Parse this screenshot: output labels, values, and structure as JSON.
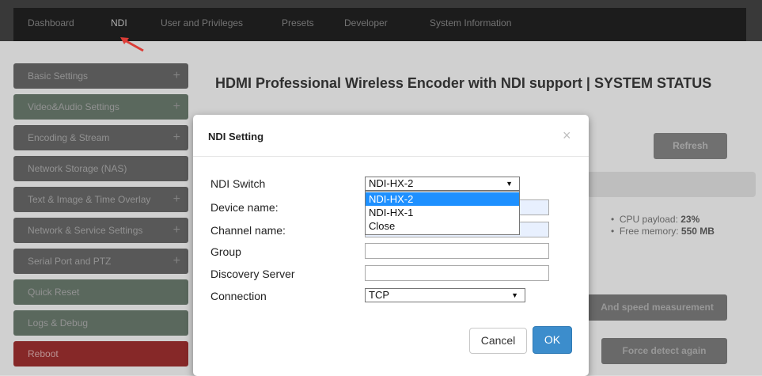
{
  "nav": {
    "tabs": [
      {
        "label": "Dashboard"
      },
      {
        "label": "NDI"
      },
      {
        "label": "User and Privileges"
      },
      {
        "label": "Presets"
      },
      {
        "label": "Developer"
      },
      {
        "label": "System Information"
      }
    ],
    "active_tab": "NDI"
  },
  "sidebar": {
    "items": [
      {
        "label": "Basic Settings",
        "expand": "+"
      },
      {
        "label": "Video&Audio Settings",
        "expand": "+"
      },
      {
        "label": "Encoding & Stream",
        "expand": "+"
      },
      {
        "label": "Network Storage (NAS)",
        "expand": ""
      },
      {
        "label": "Text & Image & Time Overlay",
        "expand": "+"
      },
      {
        "label": "Network & Service Settings",
        "expand": "+"
      },
      {
        "label": "Serial Port and PTZ",
        "expand": "+"
      },
      {
        "label": "Quick Reset",
        "expand": ""
      },
      {
        "label": "Logs & Debug",
        "expand": ""
      },
      {
        "label": "Reboot",
        "expand": ""
      }
    ]
  },
  "content": {
    "title": "HDMI Professional Wireless Encoder with NDI support | SYSTEM STATUS",
    "refresh_label": "Refresh",
    "cpu_label": "CPU payload: ",
    "cpu_value": "23%",
    "mem_label": "Free memory: ",
    "mem_value": "550 MB",
    "speed_label": "And speed measurement",
    "force_label": "Force detect again"
  },
  "modal": {
    "title": "NDI Setting",
    "close": "×",
    "fields": {
      "ndi_switch_label": "NDI Switch",
      "ndi_switch_value": "NDI-HX-2",
      "device_name_label": "Device name:",
      "channel_name_label": "Channel name:",
      "group_label": "Group",
      "discovery_label": "Discovery Server",
      "connection_label": "Connection",
      "connection_value": "TCP"
    },
    "dropdown_options": [
      "NDI-HX-2",
      "NDI-HX-1",
      "Close"
    ],
    "cancel_label": "Cancel",
    "ok_label": "OK"
  },
  "colors": {
    "accent": "#3c8dcc",
    "selected": "#1e90ff",
    "reboot": "#8e2b2b",
    "arrow": "#e8413a"
  }
}
